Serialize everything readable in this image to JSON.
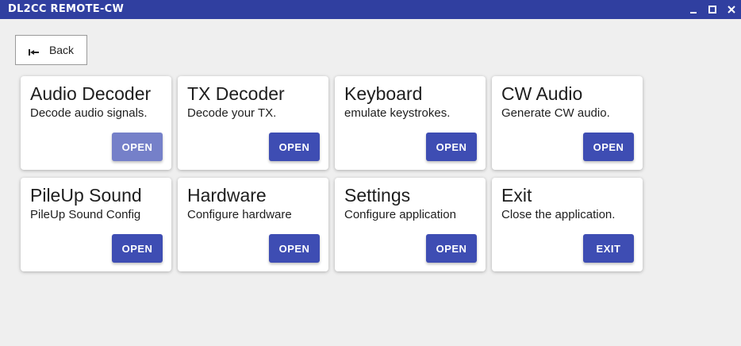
{
  "window": {
    "title": "DL2CC REMOTE-CW",
    "controls": [
      {
        "name": "minimize-icon"
      },
      {
        "name": "maximize-icon"
      },
      {
        "name": "close-icon"
      }
    ]
  },
  "nav": {
    "back_label": "Back",
    "back_icon": "back-arrow-icon"
  },
  "cards": [
    {
      "title": "Audio Decoder",
      "description": "Decode audio signals.",
      "button": "OPEN"
    },
    {
      "title": "TX Decoder",
      "description": "Decode your TX.",
      "button": "OPEN"
    },
    {
      "title": "Keyboard",
      "description": "emulate keystrokes.",
      "button": "OPEN"
    },
    {
      "title": "CW Audio",
      "description": "Generate CW audio.",
      "button": "OPEN"
    },
    {
      "title": "PileUp Sound",
      "description": "PileUp Sound Config",
      "button": "OPEN"
    },
    {
      "title": "Hardware",
      "description": "Configure hardware",
      "button": "OPEN"
    },
    {
      "title": "Settings",
      "description": "Configure application",
      "button": "OPEN"
    },
    {
      "title": "Exit",
      "description": "Close the application.",
      "button": "EXIT"
    }
  ],
  "colors": {
    "titlebar": "#303fa0",
    "button": "#3e4db3",
    "button_hover": "#7580c9",
    "background": "#efefef"
  }
}
